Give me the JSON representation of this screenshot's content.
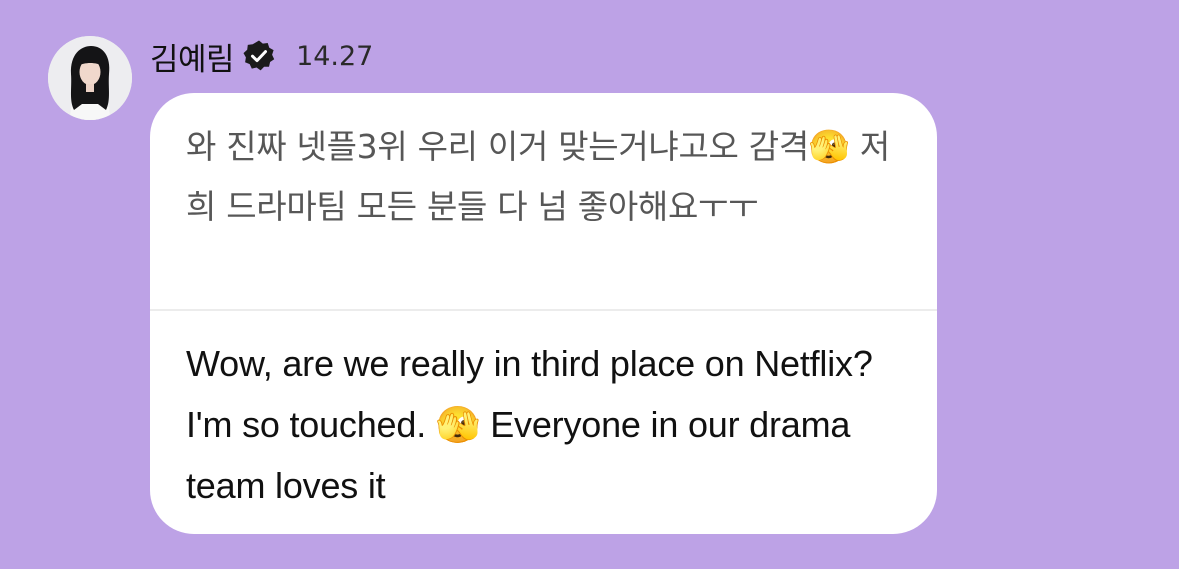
{
  "message": {
    "sender": {
      "name": "김예림",
      "verified": true
    },
    "timestamp": "14.27",
    "original_text": "와 진짜 넷플3위 우리 이거 맞는거냐고오 감격🫣 저희 드라마팀 모든 분들 다 넘 좋아해요ㅜㅜ",
    "translated_text": "Wow, are we really in third place on Netflix? I'm so touched. 🫣 Everyone in our drama team loves it"
  },
  "icons": {
    "verified": "verified-badge-icon",
    "avatar": "profile-photo"
  },
  "colors": {
    "background": "#bda2e6",
    "bubble": "#ffffff",
    "original_text": "#575757",
    "translated_text": "#111111"
  }
}
